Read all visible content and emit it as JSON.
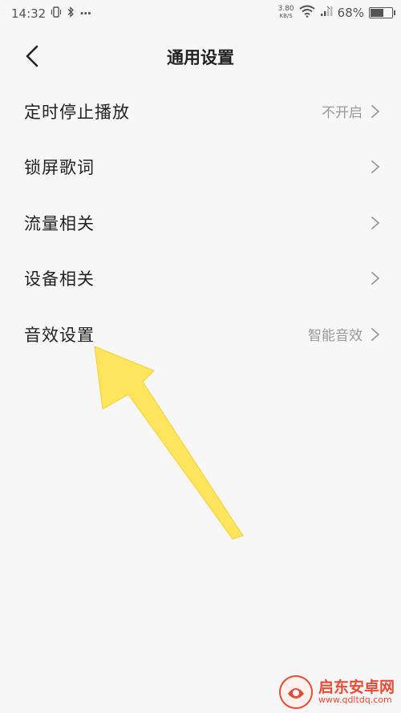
{
  "status_bar": {
    "time": "14:32",
    "dots": "···",
    "net_speed_value": "3.80",
    "net_speed_unit": "KB/S",
    "battery_percent": "68%",
    "battery_level": 0.68
  },
  "header": {
    "title": "通用设置"
  },
  "menu": {
    "items": [
      {
        "label": "定时停止播放",
        "value": "不开启"
      },
      {
        "label": "锁屏歌词",
        "value": ""
      },
      {
        "label": "流量相关",
        "value": ""
      },
      {
        "label": "设备相关",
        "value": ""
      },
      {
        "label": "音效设置",
        "value": "智能音效"
      }
    ]
  },
  "watermark": {
    "title": "启东安卓网",
    "url": "www.qdltdq.com"
  },
  "colors": {
    "background": "#f7f7f7",
    "arrow": "#ffe45c",
    "watermark": "#e94b36"
  }
}
